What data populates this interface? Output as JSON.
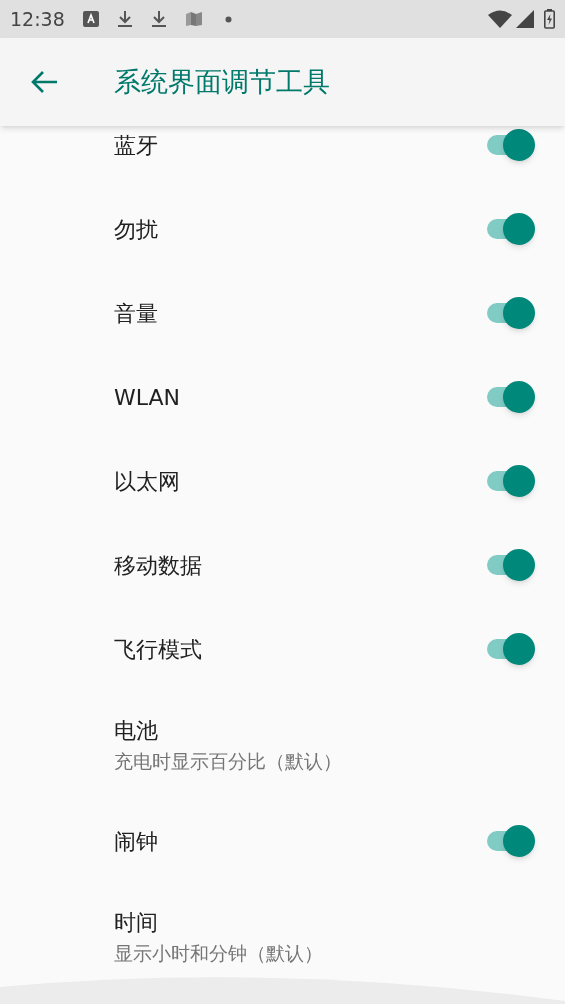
{
  "status_bar": {
    "time": "12:38"
  },
  "app_bar": {
    "title": "系统界面调节工具"
  },
  "items": [
    {
      "kind": "toggle",
      "title": "蓝牙",
      "on": true
    },
    {
      "kind": "toggle",
      "title": "勿扰",
      "on": true
    },
    {
      "kind": "toggle",
      "title": "音量",
      "on": true
    },
    {
      "kind": "toggle",
      "title": "WLAN",
      "on": true
    },
    {
      "kind": "toggle",
      "title": "以太网",
      "on": true
    },
    {
      "kind": "toggle",
      "title": "移动数据",
      "on": true
    },
    {
      "kind": "toggle",
      "title": "飞行模式",
      "on": true
    },
    {
      "kind": "choice",
      "title": "电池",
      "summary": "充电时显示百分比（默认）"
    },
    {
      "kind": "toggle",
      "title": "闹钟",
      "on": true
    },
    {
      "kind": "choice",
      "title": "时间",
      "summary": "显示小时和分钟（默认）"
    }
  ]
}
